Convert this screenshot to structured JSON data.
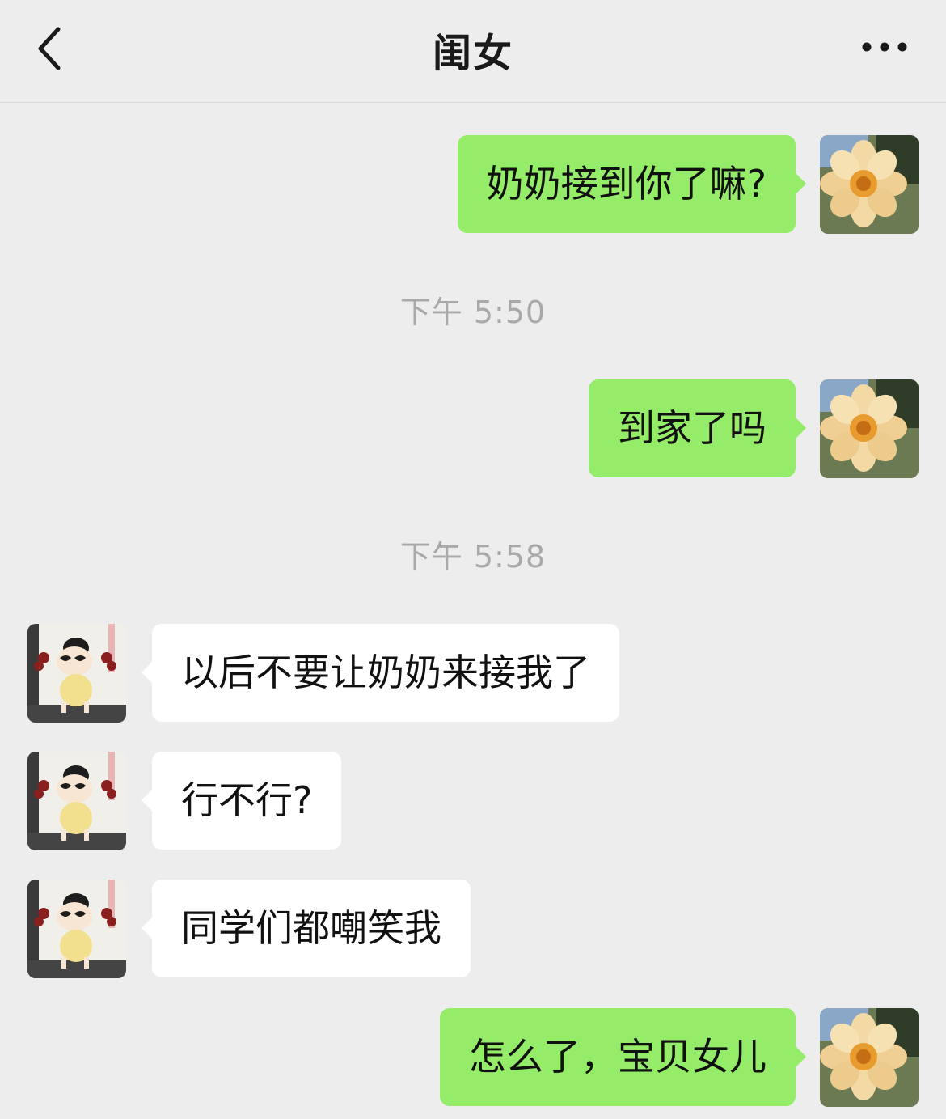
{
  "header": {
    "title": "闺女",
    "back_icon": "chevron-left-icon",
    "more_icon": "more-horizontal-icon"
  },
  "colors": {
    "background": "#ededed",
    "my_bubble": "#95ec69",
    "their_bubble": "#ffffff",
    "timestamp_text": "#a9a9a9"
  },
  "messages": [
    {
      "sender": "me",
      "text": "奶奶接到你了嘛?"
    },
    {
      "timestamp": "下午 5:50"
    },
    {
      "sender": "me",
      "text": "到家了吗"
    },
    {
      "timestamp": "下午 5:58"
    },
    {
      "sender": "them",
      "text": "以后不要让奶奶来接我了"
    },
    {
      "sender": "them",
      "text": "行不行?"
    },
    {
      "sender": "them",
      "text": "同学们都嘲笑我"
    },
    {
      "sender": "me",
      "text": "怎么了，宝贝女儿"
    }
  ]
}
